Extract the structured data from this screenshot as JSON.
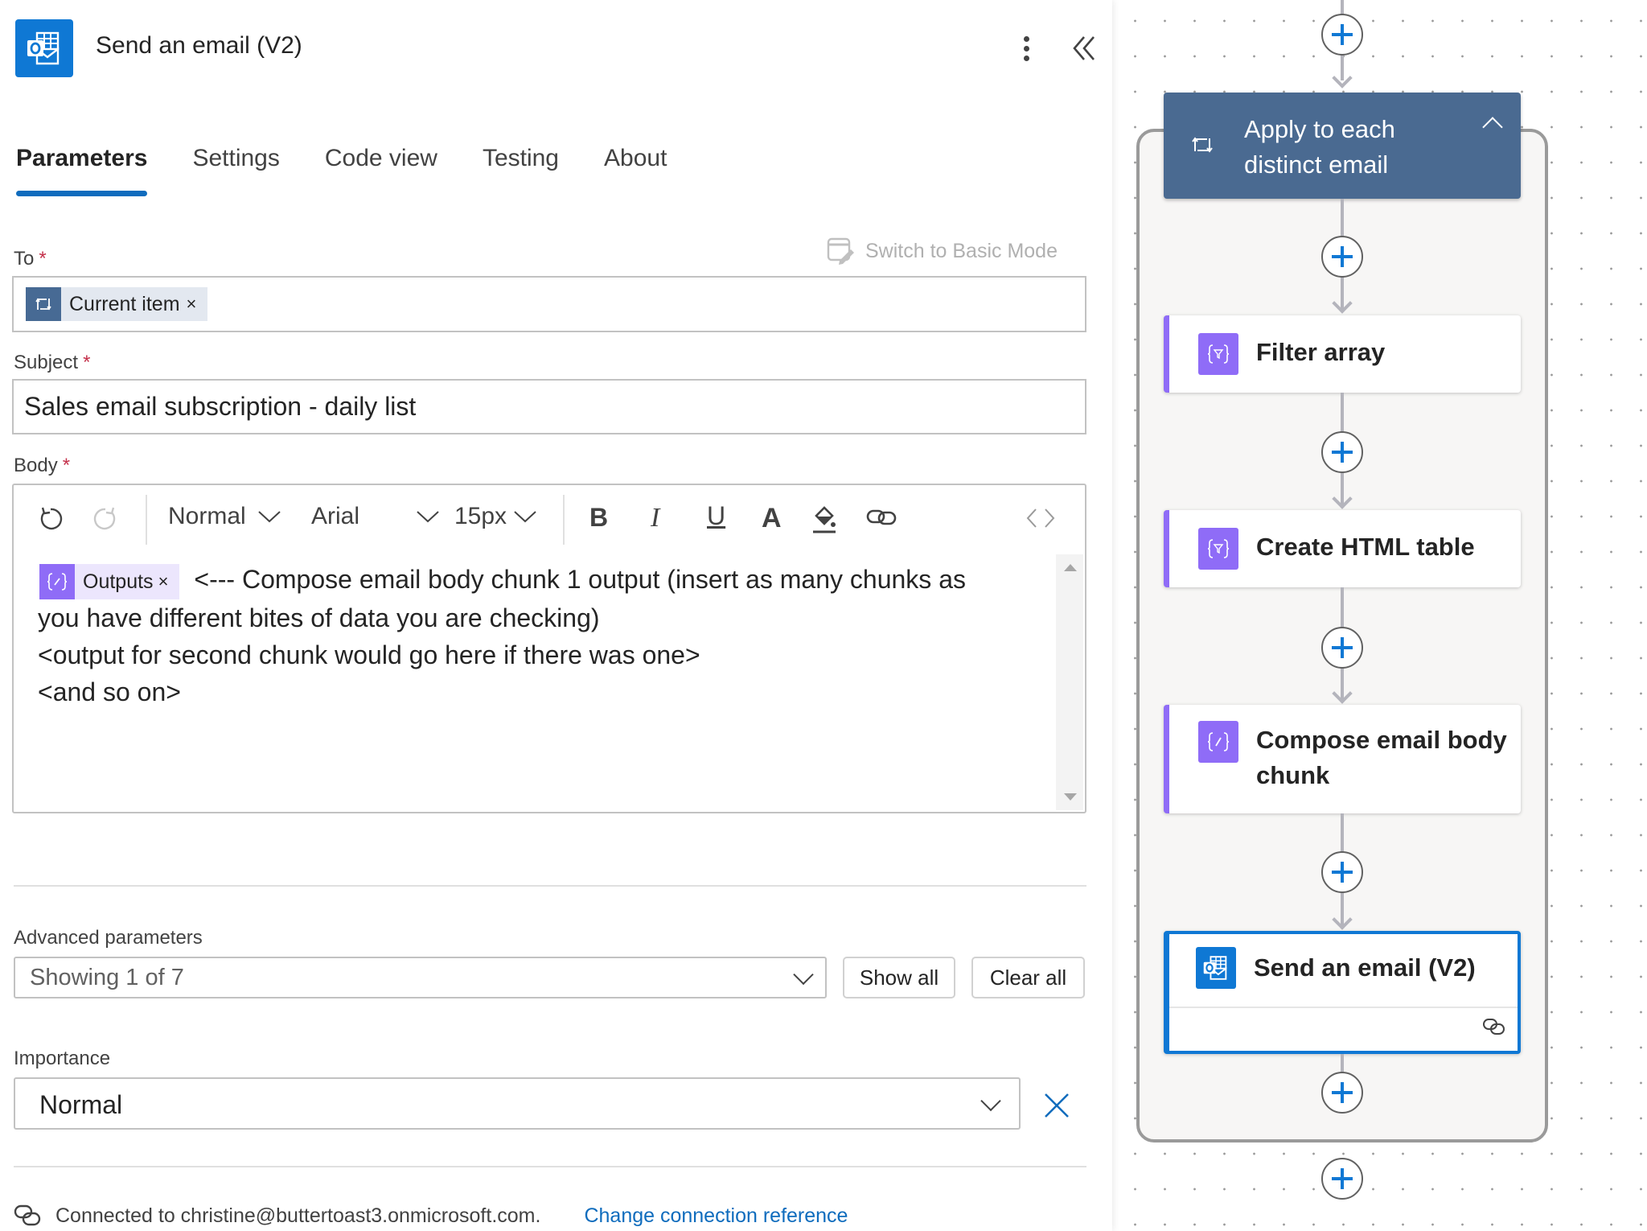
{
  "panel": {
    "title": "Send an email (V2)",
    "icon": "outlook-icon",
    "more_icon": "more-vertical-icon",
    "collapse_icon": "double-chevron-left-icon",
    "tabs": [
      {
        "label": "Parameters",
        "active": true
      },
      {
        "label": "Settings",
        "active": false
      },
      {
        "label": "Code view",
        "active": false
      },
      {
        "label": "Testing",
        "active": false
      },
      {
        "label": "About",
        "active": false
      }
    ],
    "switch_mode_label": "Switch to Basic Mode",
    "fields": {
      "to": {
        "label": "To",
        "required": "*",
        "token": {
          "label": "Current item",
          "remove": "×",
          "icon": "loop-icon",
          "color": "#476a94"
        }
      },
      "subject": {
        "label": "Subject",
        "required": "*",
        "value": "Sales email subscription - daily list"
      },
      "body": {
        "label": "Body",
        "required": "*",
        "toolbar": {
          "undo": "undo-icon",
          "redo": "redo-icon",
          "block_format": "Normal",
          "font": "Arial",
          "font_size": "15px",
          "bold": "B",
          "italic": "I",
          "underline": "U",
          "font_color": "A",
          "highlight": "paint-bucket-icon",
          "link": "link-icon",
          "code_view": "code-icon"
        },
        "token": {
          "label": "Outputs",
          "remove": "×",
          "icon": "compose-expression-icon",
          "color": "#8f6cf7"
        },
        "line1_after_token": "<--- Compose email body chunk 1 output (insert as many chunks as",
        "line2": "you have different bites of data you are checking)",
        "line3": "<output for second chunk would go here if there was one>",
        "line4": "<and so on>"
      }
    },
    "advanced": {
      "label": "Advanced parameters",
      "dropdown_value": "Showing 1 of 7",
      "show_all": "Show all",
      "clear_all": "Clear all"
    },
    "importance": {
      "label": "Importance",
      "value": "Normal",
      "clear_icon": "close-icon"
    },
    "connection": {
      "text": "Connected to christine@buttertoast3.onmicrosoft.com.",
      "link": "Change connection reference",
      "icon": "connection-link-icon"
    }
  },
  "canvas": {
    "loop": {
      "title": "Apply to each distinct email",
      "icon": "loop-icon",
      "collapse_icon": "chevron-up-icon",
      "color": "#4a6a91"
    },
    "actions": [
      {
        "title": "Filter array",
        "icon": "filter-array-icon",
        "color": "#8f6cf7"
      },
      {
        "title": "Create HTML table",
        "icon": "filter-array-icon",
        "color": "#8f6cf7"
      },
      {
        "title": "Compose email body chunk",
        "icon": "compose-icon",
        "color": "#8f6cf7"
      },
      {
        "title": "Send an email (V2)",
        "icon": "outlook-icon",
        "color": "#0f78d4",
        "selected": true
      }
    ],
    "add_step_icon": "plus-icon"
  },
  "colors": {
    "accent": "#0f6cbd",
    "required": "#c4314b",
    "data_operation": "#8f6cf7",
    "outlook": "#0f78d4",
    "loop": "#4a6a91"
  }
}
